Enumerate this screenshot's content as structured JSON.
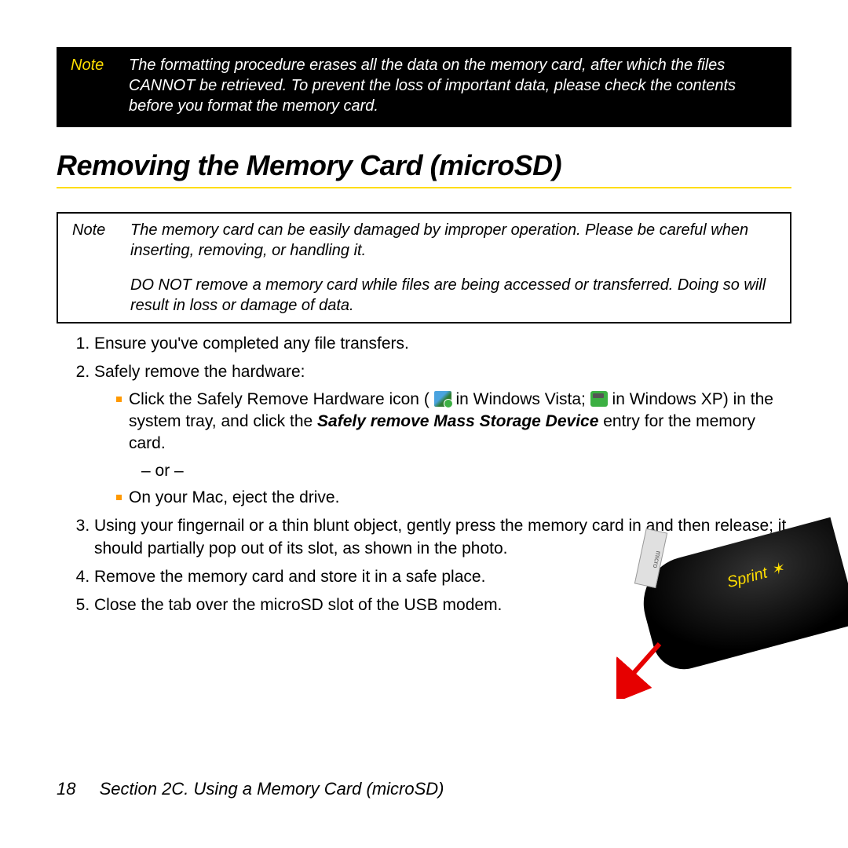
{
  "noteTop": {
    "label": "Note",
    "text": "The formatting procedure erases all the data on the memory card, after which the files CANNOT be retrieved. To prevent the loss of important data, please check the contents before you format the memory card."
  },
  "heading": "Removing the Memory Card (microSD)",
  "noteBox": {
    "label": "Note",
    "para1": "The memory card can be easily damaged by improper operation. Please be careful when inserting, removing, or handling it.",
    "para2": "DO NOT remove a memory card while files are being accessed or transferred. Doing so will result in loss or damage of data."
  },
  "steps": {
    "s1": "Ensure you've completed any file transfers.",
    "s2": "Safely remove the hardware:",
    "s2a_pre": "Click the Safely Remove Hardware icon (",
    "s2a_mid1": " in Windows Vista; ",
    "s2a_mid2": " in Windows XP) in the system tray, and click the ",
    "s2a_bold": "Safely remove Mass Storage Device",
    "s2a_post": " entry for the memory card.",
    "s2_or": "– or –",
    "s2b": "On your Mac, eject the drive.",
    "s3": "Using your fingernail or a thin blunt object, gently press the memory card in and then release; it should partially pop out of its slot, as shown in the photo.",
    "s4": "Remove the memory card and store it in a safe place.",
    "s5": "Close the tab over the microSD slot of the USB modem."
  },
  "photo": {
    "brand": "Sprint",
    "card": "micro"
  },
  "footer": {
    "page": "18",
    "section": "Section 2C. Using a Memory Card (microSD)"
  }
}
